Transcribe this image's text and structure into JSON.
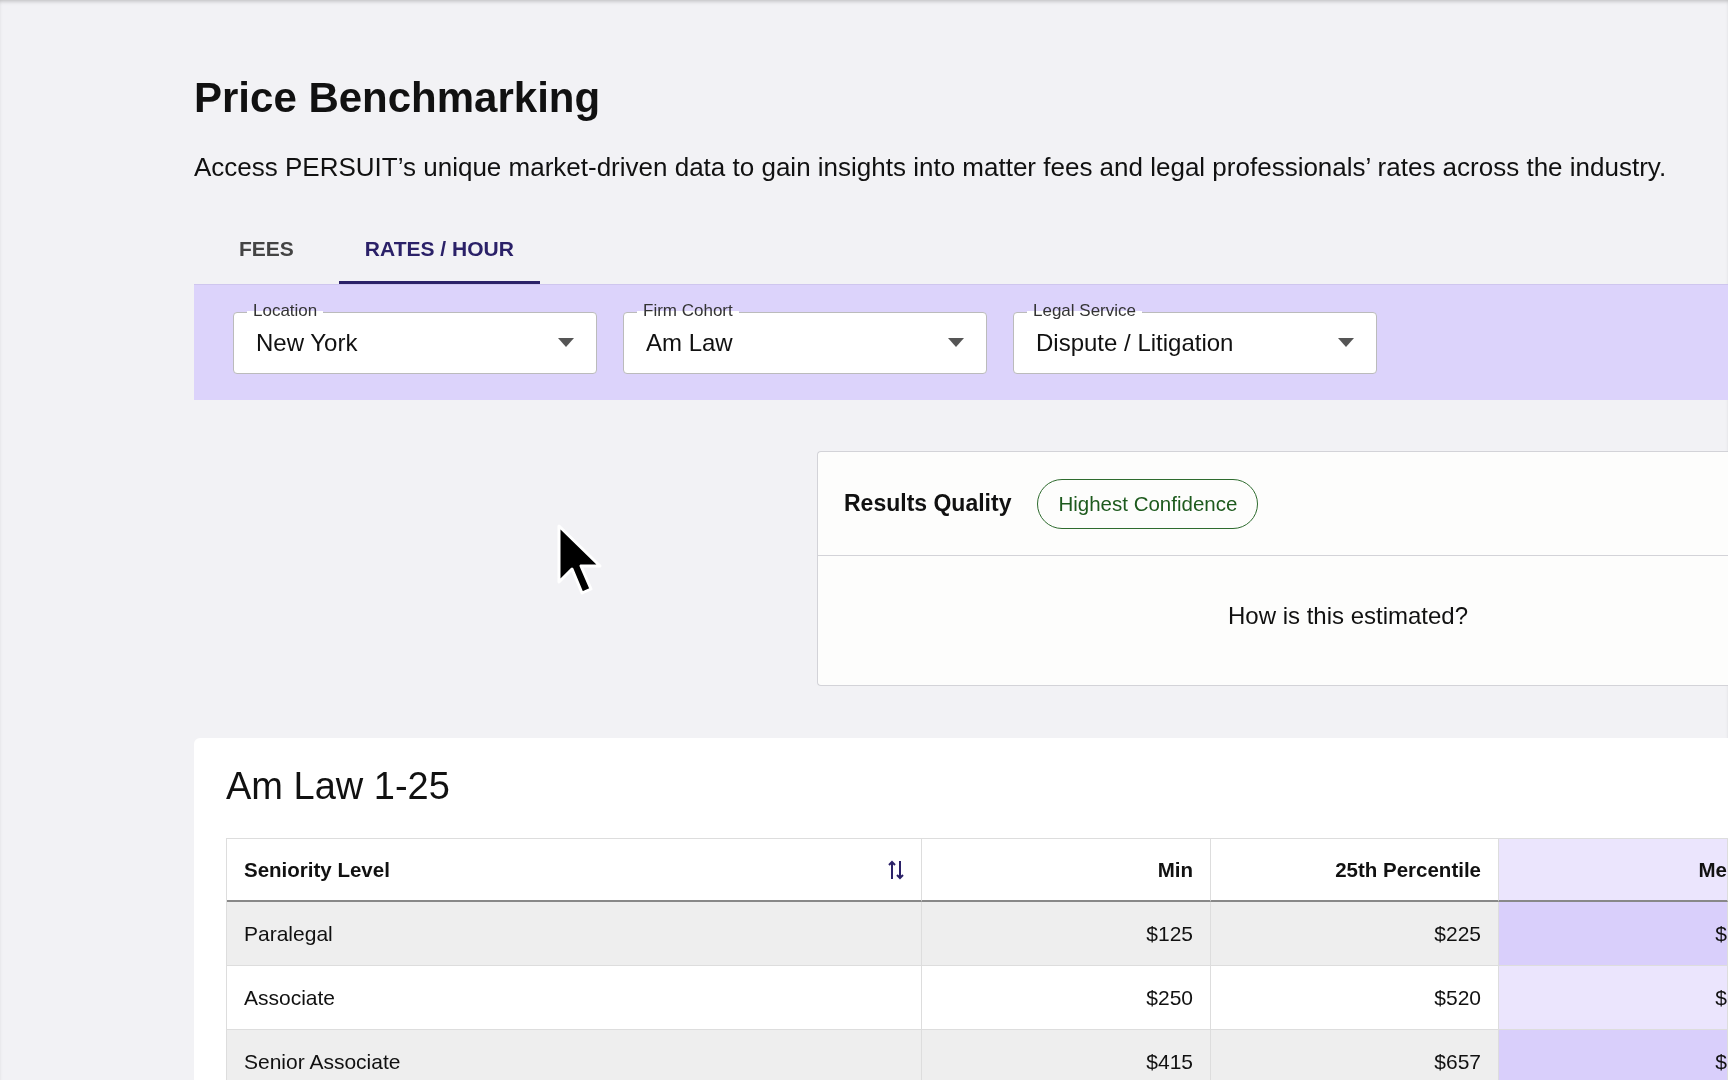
{
  "page": {
    "title": "Price Benchmarking",
    "description": "Access PERSUIT’s unique market-driven data to gain insights into matter fees and legal professionals’ rates across the industry."
  },
  "tabs": [
    {
      "label": "FEES",
      "selected": false
    },
    {
      "label": "RATES / HOUR",
      "selected": true
    }
  ],
  "filters": [
    {
      "label": "Location",
      "value": "New York"
    },
    {
      "label": "Firm Cohort",
      "value": "Am Law"
    },
    {
      "label": "Legal Service",
      "value": "Dispute / Litigation"
    }
  ],
  "results_quality": {
    "label": "Results Quality",
    "badge": "Highest Confidence",
    "link": "How is this estimated?"
  },
  "table": {
    "title": "Am Law 1-25",
    "columns": [
      "Seniority Level",
      "Min",
      "25th Percentile",
      "Me"
    ],
    "rows": [
      [
        "Paralegal",
        "$125",
        "$225",
        "$"
      ],
      [
        "Associate",
        "$250",
        "$520",
        "$"
      ],
      [
        "Senior Associate",
        "$415",
        "$657",
        "$"
      ]
    ]
  }
}
